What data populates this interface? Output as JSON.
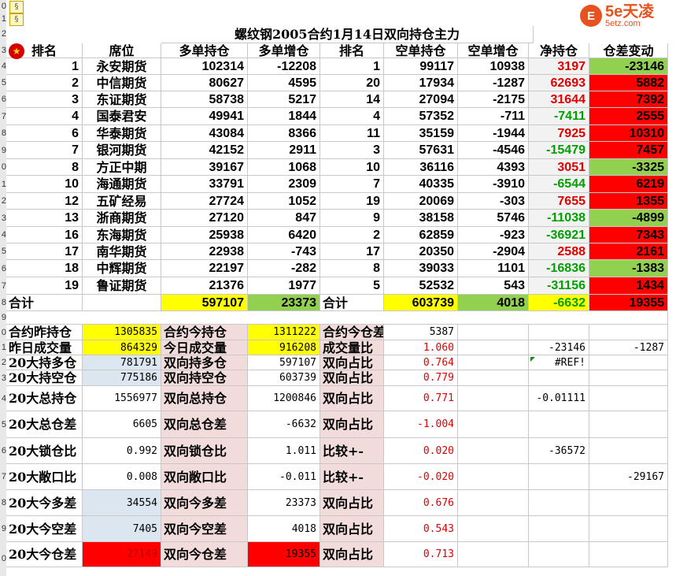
{
  "sheet_title": "螺纹钢2005合约1月14日双向持仓主力",
  "row_numbers": [
    "0",
    "1",
    "2",
    "3",
    "4",
    "5",
    "6",
    "7",
    "8",
    "9",
    "0",
    "1",
    "2",
    "3",
    "4",
    "5",
    "6",
    "7",
    "8",
    "9",
    "0",
    "1",
    "2",
    "3",
    "4",
    "5",
    "6",
    "7",
    "8",
    "9",
    "0"
  ],
  "logo": {
    "brand": "5e天凌",
    "domain": "5etz.com",
    "circle": "E"
  },
  "headers": [
    "排名",
    "席位",
    "多单持仓",
    "多单增仓",
    "排名",
    "空单持仓",
    "空单增仓",
    "净持仓",
    "仓差变动"
  ],
  "rows": [
    {
      "rank": "1",
      "seat": "永安期货",
      "long": "102314",
      "long_chg": "-12208",
      "srank": "1",
      "short": "99117",
      "short_chg": "10938",
      "net": "3197",
      "net_color": "red",
      "diff": "-23146",
      "diff_bg": "grn"
    },
    {
      "rank": "2",
      "seat": "中信期货",
      "long": "80627",
      "long_chg": "4595",
      "srank": "20",
      "short": "17934",
      "short_chg": "-1287",
      "net": "62693",
      "net_color": "red",
      "diff": "5882",
      "diff_bg": "red"
    },
    {
      "rank": "3",
      "seat": "东证期货",
      "long": "58738",
      "long_chg": "5217",
      "srank": "14",
      "short": "27094",
      "short_chg": "-2175",
      "net": "31644",
      "net_color": "red",
      "diff": "7392",
      "diff_bg": "red"
    },
    {
      "rank": "4",
      "seat": "国泰君安",
      "long": "49941",
      "long_chg": "1844",
      "srank": "4",
      "short": "57352",
      "short_chg": "-711",
      "net": "-7411",
      "net_color": "grn",
      "diff": "2555",
      "diff_bg": "red"
    },
    {
      "rank": "6",
      "seat": "华泰期货",
      "long": "43084",
      "long_chg": "8366",
      "srank": "11",
      "short": "35159",
      "short_chg": "-1944",
      "net": "7925",
      "net_color": "red",
      "diff": "10310",
      "diff_bg": "red"
    },
    {
      "rank": "7",
      "seat": "银河期货",
      "long": "42152",
      "long_chg": "2911",
      "srank": "3",
      "short": "57631",
      "short_chg": "-4546",
      "net": "-15479",
      "net_color": "grn",
      "diff": "7457",
      "diff_bg": "red"
    },
    {
      "rank": "8",
      "seat": "方正中期",
      "long": "39167",
      "long_chg": "1068",
      "srank": "10",
      "short": "36116",
      "short_chg": "4393",
      "net": "3051",
      "net_color": "red",
      "diff": "-3325",
      "diff_bg": "grn"
    },
    {
      "rank": "10",
      "seat": "海通期货",
      "long": "33791",
      "long_chg": "2309",
      "srank": "7",
      "short": "40335",
      "short_chg": "-3910",
      "net": "-6544",
      "net_color": "grn",
      "diff": "6219",
      "diff_bg": "red"
    },
    {
      "rank": "12",
      "seat": "五矿经易",
      "long": "27724",
      "long_chg": "1052",
      "srank": "19",
      "short": "20069",
      "short_chg": "-303",
      "net": "7655",
      "net_color": "red",
      "diff": "1355",
      "diff_bg": "red"
    },
    {
      "rank": "13",
      "seat": "浙商期货",
      "long": "27120",
      "long_chg": "847",
      "srank": "9",
      "short": "38158",
      "short_chg": "5746",
      "net": "-11038",
      "net_color": "grn",
      "diff": "-4899",
      "diff_bg": "grn"
    },
    {
      "rank": "16",
      "seat": "东海期货",
      "long": "25938",
      "long_chg": "6420",
      "srank": "2",
      "short": "62859",
      "short_chg": "-923",
      "net": "-36921",
      "net_color": "grn",
      "diff": "7343",
      "diff_bg": "red"
    },
    {
      "rank": "17",
      "seat": "南华期货",
      "long": "22938",
      "long_chg": "-743",
      "srank": "17",
      "short": "20350",
      "short_chg": "-2904",
      "net": "2588",
      "net_color": "red",
      "diff": "2161",
      "diff_bg": "red"
    },
    {
      "rank": "18",
      "seat": "中辉期货",
      "long": "22197",
      "long_chg": "-282",
      "srank": "8",
      "short": "39033",
      "short_chg": "1101",
      "net": "-16836",
      "net_color": "grn",
      "diff": "-1383",
      "diff_bg": "grn"
    },
    {
      "rank": "19",
      "seat": "鲁证期货",
      "long": "21376",
      "long_chg": "1977",
      "srank": "5",
      "short": "52532",
      "short_chg": "543",
      "net": "-31156",
      "net_color": "grn",
      "diff": "1434",
      "diff_bg": "red"
    }
  ],
  "total": {
    "label": "合计",
    "long": "597107",
    "long_chg": "23373",
    "label2": "合计",
    "short": "603739",
    "short_chg": "4018",
    "net": "-6632",
    "diff": "19355"
  },
  "stats": [
    {
      "a": "合约昨持仓",
      "av": "1305835",
      "av_bg": "yel",
      "b": "合约今持仓",
      "bv": "1311222",
      "bv_bg": "yel",
      "c": "合约今仓差",
      "cv": "5387",
      "cv_color": "black",
      "x1": "",
      "x2": ""
    },
    {
      "a": "昨日成交量",
      "av": "864329",
      "av_bg": "yel",
      "b": "今日成交量",
      "bv": "916208",
      "bv_bg": "yel",
      "c": "成交量比",
      "cv": "1.060",
      "cv_color": "red",
      "x1": "-23146",
      "x2": "-1287"
    },
    {
      "a": "20大持多仓",
      "av": "781791",
      "av_bg": "blue",
      "b": "双向持多仓",
      "bv": "597107",
      "bv_bg": "none",
      "c": "双向占比",
      "cv": "0.764",
      "cv_color": "red",
      "x1": "#REF!",
      "x2": ""
    },
    {
      "a": "20大持空仓",
      "av": "775186",
      "av_bg": "blue",
      "b": "双向持空仓",
      "bv": "603739",
      "bv_bg": "none",
      "c": "双向占比",
      "cv": "0.779",
      "cv_color": "red",
      "x1": "",
      "x2": ""
    },
    {
      "a": "20大总持仓",
      "av": "1556977",
      "av_bg": "none",
      "b": "双向总持仓",
      "bv": "1200846",
      "bv_bg": "none",
      "c": "双向占比",
      "cv": "0.771",
      "cv_color": "red",
      "x1": "-0.01111",
      "x2": ""
    },
    {
      "a": "20大总仓差",
      "av": "6605",
      "av_bg": "none",
      "b": "双向总仓差",
      "bv": "-6632",
      "bv_bg": "none",
      "c": "双向占比",
      "cv": "-1.004",
      "cv_color": "red",
      "x1": "",
      "x2": ""
    },
    {
      "a": "20大锁仓比",
      "av": "0.992",
      "av_bg": "none",
      "b": "双向锁仓比",
      "bv": "1.011",
      "bv_bg": "none",
      "c": "比较+-",
      "cv": "0.020",
      "cv_color": "red",
      "x1": "-36572",
      "x2": ""
    },
    {
      "a": "20大敞口比",
      "av": "0.008",
      "av_bg": "none",
      "b": "双向敞口比",
      "bv": "-0.011",
      "bv_bg": "none",
      "c": "比较+-",
      "cv": "-0.020",
      "cv_color": "red",
      "x1": "",
      "x2": "-29167"
    },
    {
      "a": "20大今多差",
      "av": "34554",
      "av_bg": "blue",
      "b": "双向今多差",
      "bv": "23373",
      "bv_bg": "none",
      "c": "双向占比",
      "cv": "0.676",
      "cv_color": "red",
      "x1": "",
      "x2": ""
    },
    {
      "a": "20大今空差",
      "av": "7405",
      "av_bg": "blue",
      "b": "双向今空差",
      "bv": "4018",
      "bv_bg": "none",
      "c": "双向占比",
      "cv": "0.543",
      "cv_color": "red",
      "x1": "",
      "x2": ""
    },
    {
      "a": "20大今仓差",
      "av": "27149",
      "av_bg": "red",
      "b": "双向今仓差",
      "bv": "19355",
      "bv_bg": "red",
      "c": "双向占比",
      "cv": "0.713",
      "cv_color": "red",
      "x1": "",
      "x2": ""
    }
  ]
}
